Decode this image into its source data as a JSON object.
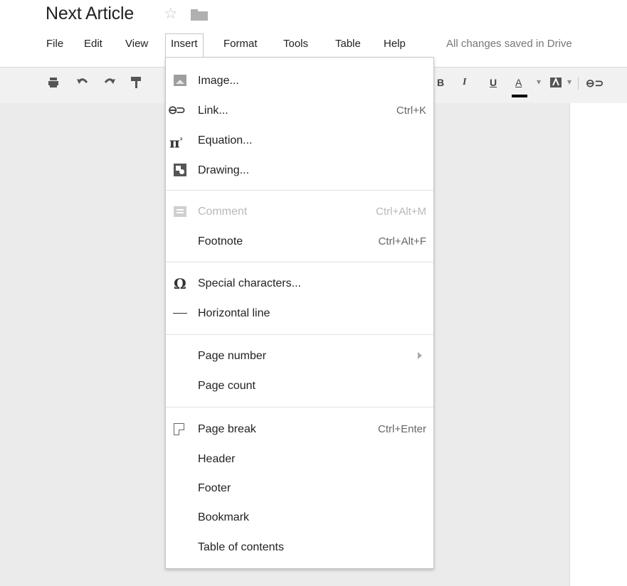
{
  "document": {
    "title": "Next Article",
    "star_icon": "star-icon",
    "folder_icon": "folder-icon"
  },
  "menubar": {
    "items": [
      "File",
      "Edit",
      "View",
      "Insert",
      "Format",
      "Tools",
      "Table",
      "Help"
    ],
    "open_item": "Insert",
    "save_status": "All changes saved in Drive"
  },
  "toolbar": {
    "icons": [
      "print-icon",
      "undo-icon",
      "redo-icon",
      "paint-format-icon"
    ],
    "bold": "B",
    "italic": "I",
    "underline": "U",
    "text_color": "A",
    "text_color_arrow": "▾",
    "highlight_arrow": "▾",
    "text_color_value": "#000000"
  },
  "insert_menu": {
    "items": [
      {
        "label": "Image...",
        "shortcut": "",
        "icon": "image-icon"
      },
      {
        "label": "Link...",
        "shortcut": "Ctrl+K",
        "icon": "link-icon"
      },
      {
        "label": "Equation...",
        "shortcut": "",
        "icon": "equation-icon"
      },
      {
        "label": "Drawing...",
        "shortcut": "",
        "icon": "drawing-icon"
      },
      {
        "label": "Comment",
        "shortcut": "Ctrl+Alt+M",
        "icon": "comment-icon",
        "disabled": true
      },
      {
        "label": "Footnote",
        "shortcut": "Ctrl+Alt+F"
      },
      {
        "label": "Special characters...",
        "shortcut": "",
        "icon": "omega-icon"
      },
      {
        "label": "Horizontal line",
        "shortcut": "",
        "icon": "horizontal-line-icon"
      },
      {
        "label": "Page number",
        "shortcut": "",
        "submenu": true
      },
      {
        "label": "Page count",
        "shortcut": ""
      },
      {
        "label": "Page break",
        "shortcut": "Ctrl+Enter",
        "icon": "page-break-icon"
      },
      {
        "label": "Header",
        "shortcut": ""
      },
      {
        "label": "Footer",
        "shortcut": ""
      },
      {
        "label": "Bookmark",
        "shortcut": ""
      },
      {
        "label": "Table of contents",
        "shortcut": ""
      }
    ]
  },
  "glyphs": {
    "star": "☆",
    "link": "⊖⊃",
    "pi": "π",
    "pi_sup": "²",
    "omega": "Ω"
  }
}
